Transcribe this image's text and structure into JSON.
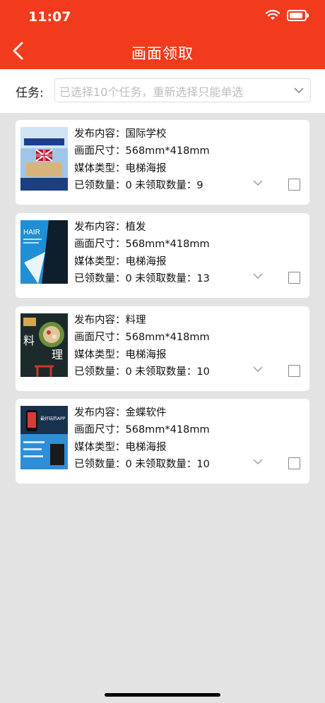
{
  "status_bar": {
    "time": "11:07"
  },
  "header": {
    "title": "画面领取"
  },
  "task": {
    "label": "任务:",
    "placeholder": "已选择10个任务，重新选择只能单选"
  },
  "labels": {
    "content": "发布内容：",
    "size": "画面尺寸：",
    "media": "媒体类型：",
    "claimed": "已领数量：",
    "unclaimed": "未领取数量："
  },
  "cards": [
    {
      "content": "国际学校",
      "size": "568mm*418mm",
      "media": "电梯海报",
      "claimed": "0",
      "unclaimed": "9"
    },
    {
      "content": "植发",
      "size": "568mm*418mm",
      "media": "电梯海报",
      "claimed": "0",
      "unclaimed": "13"
    },
    {
      "content": "料理",
      "size": "568mm*418mm",
      "media": "电梯海报",
      "claimed": "0",
      "unclaimed": "10"
    },
    {
      "content": "金蝶软件",
      "size": "568mm*418mm",
      "media": "电梯海报",
      "claimed": "0",
      "unclaimed": "10"
    }
  ],
  "poster_text": {
    "p2_brand": "HAIR",
    "p3_word1": "料",
    "p3_word2": "理",
    "p4_title": "最好玩的APP"
  },
  "icons": {
    "back": "back-arrow-icon",
    "wifi": "wifi-icon",
    "battery": "battery-icon",
    "dropdown": "chevron-down-icon",
    "checkbox": "checkbox-icon"
  },
  "colors": {
    "header_bg": "#f23a1c",
    "page_bg": "#e3e3e3"
  }
}
